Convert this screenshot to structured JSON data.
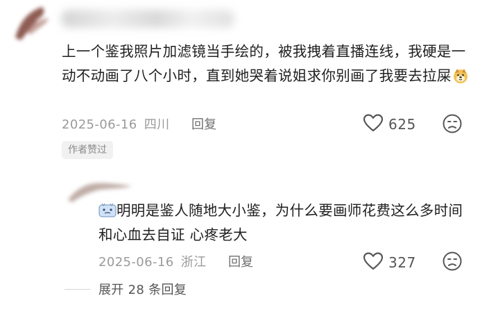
{
  "comment": {
    "text": "上一个鉴我照片加滤镜当手绘的，被我拽着直播连线，我硬是一动不动画了八个小时，直到她哭着说姐求你别画了我要去拉屎",
    "emoji": "dog-face-emoji",
    "date": "2025-06-16",
    "location": "四川",
    "reply_label": "回复",
    "likes": "625",
    "author_badge": "作者赞过"
  },
  "reply": {
    "emoji": "sweat-face-emoji",
    "text": "明明是鉴人随地大小鉴，为什么要画师花费这么多时间和心血去自证 心疼老大",
    "date": "2025-06-16",
    "location": "浙江",
    "reply_label": "回复",
    "likes": "327"
  },
  "expand_label": "展开 28 条回复",
  "icons": {
    "like": "heart-outline-icon",
    "dislike": "frown-face-icon"
  },
  "colors": {
    "text": "#1f1f1f",
    "meta": "#9a9a9a",
    "badge_bg": "#f1f1f1"
  }
}
